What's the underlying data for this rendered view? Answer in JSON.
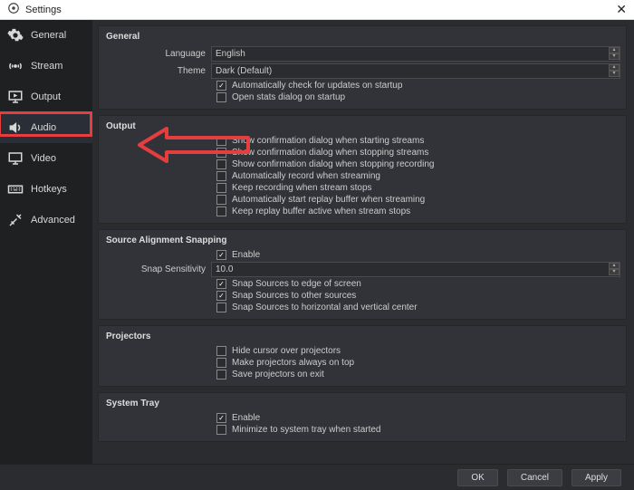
{
  "window": {
    "title": "Settings"
  },
  "sidebar": [
    {
      "name": "general",
      "label": "General",
      "icon": "gear-icon"
    },
    {
      "name": "stream",
      "label": "Stream",
      "icon": "broadcast-icon"
    },
    {
      "name": "output",
      "label": "Output",
      "icon": "output-icon"
    },
    {
      "name": "audio",
      "label": "Audio",
      "icon": "speaker-icon",
      "active": true,
      "highlight": true
    },
    {
      "name": "video",
      "label": "Video",
      "icon": "monitor-icon"
    },
    {
      "name": "hotkeys",
      "label": "Hotkeys",
      "icon": "keyboard-icon"
    },
    {
      "name": "advanced",
      "label": "Advanced",
      "icon": "tools-icon"
    }
  ],
  "general_group": {
    "title": "General",
    "language_label": "Language",
    "language_value": "English",
    "theme_label": "Theme",
    "theme_value": "Dark (Default)",
    "auto_updates": {
      "checked": true,
      "label": "Automatically check for updates on startup"
    },
    "stats_dialog": {
      "checked": false,
      "label": "Open stats dialog on startup"
    }
  },
  "output_group": {
    "title": "Output",
    "items": [
      {
        "checked": false,
        "label": "Show confirmation dialog when starting streams"
      },
      {
        "checked": false,
        "label": "Show confirmation dialog when stopping streams"
      },
      {
        "checked": false,
        "label": "Show confirmation dialog when stopping recording"
      },
      {
        "checked": false,
        "label": "Automatically record when streaming"
      },
      {
        "checked": false,
        "label": "Keep recording when stream stops"
      },
      {
        "checked": false,
        "label": "Automatically start replay buffer when streaming"
      },
      {
        "checked": false,
        "label": "Keep replay buffer active when stream stops"
      }
    ]
  },
  "snap_group": {
    "title": "Source Alignment Snapping",
    "enable": {
      "checked": true,
      "label": "Enable"
    },
    "sensitivity_label": "Snap Sensitivity",
    "sensitivity_value": "10.0",
    "items": [
      {
        "checked": true,
        "label": "Snap Sources to edge of screen"
      },
      {
        "checked": true,
        "label": "Snap Sources to other sources"
      },
      {
        "checked": false,
        "label": "Snap Sources to horizontal and vertical center"
      }
    ]
  },
  "proj_group": {
    "title": "Projectors",
    "items": [
      {
        "checked": false,
        "label": "Hide cursor over projectors"
      },
      {
        "checked": false,
        "label": "Make projectors always on top"
      },
      {
        "checked": false,
        "label": "Save projectors on exit"
      }
    ]
  },
  "tray_group": {
    "title": "System Tray",
    "enable": {
      "checked": true,
      "label": "Enable"
    },
    "minimize": {
      "checked": false,
      "label": "Minimize to system tray when started"
    }
  },
  "buttons": {
    "ok": "OK",
    "cancel": "Cancel",
    "apply": "Apply"
  }
}
